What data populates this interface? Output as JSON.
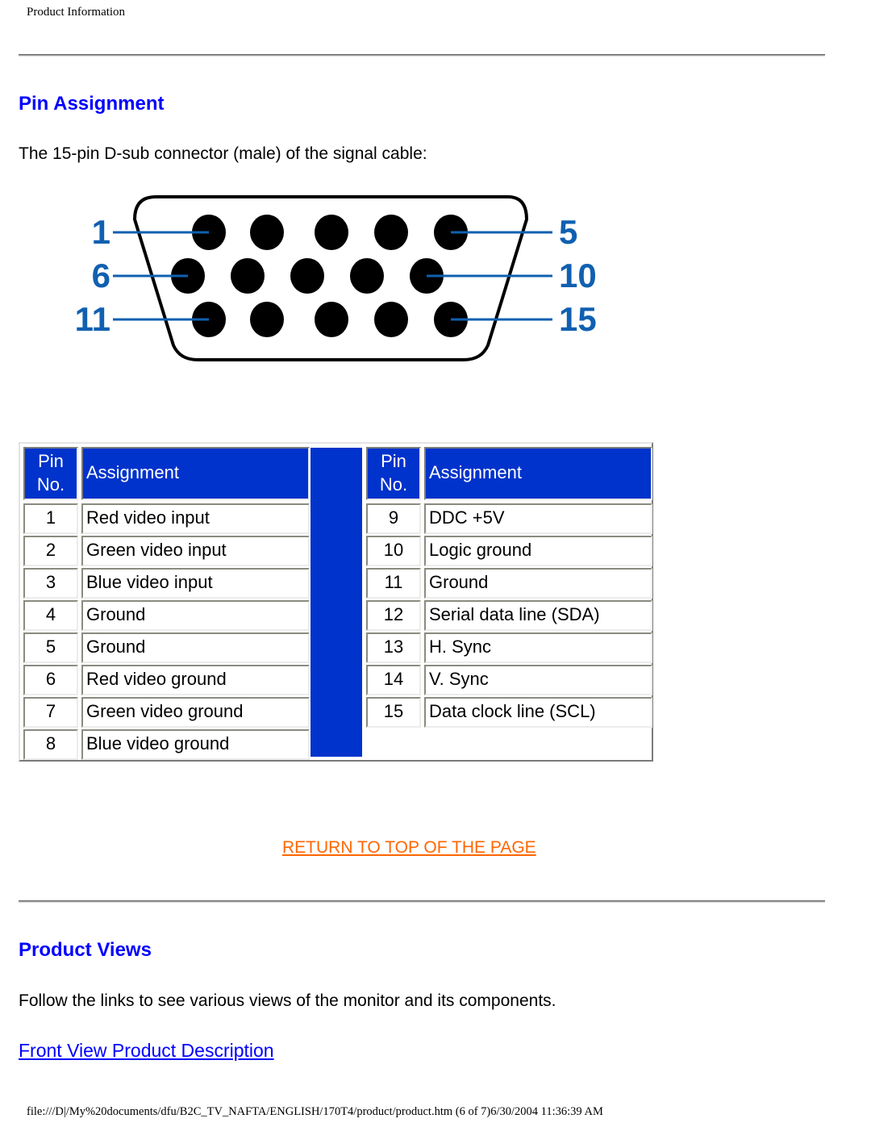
{
  "header": {
    "title": "Product Information"
  },
  "pin_assignment": {
    "heading": "Pin Assignment",
    "intro": "The 15-pin D-sub connector (male) of the signal cable:",
    "diagram": {
      "icon": "vga-connector-diagram",
      "row_labels": [
        {
          "left": "1",
          "right": "5"
        },
        {
          "left": "6",
          "right": "10"
        },
        {
          "left": "11",
          "right": "15"
        }
      ],
      "pin_color": "#000000",
      "label_color": "#1060b0"
    },
    "table": {
      "header_color": "#0033cc",
      "left": {
        "col_pin": "Pin No.",
        "col_pin_line1": "Pin",
        "col_pin_line2": "No.",
        "col_assign": "Assignment",
        "rows": [
          {
            "pin": "1",
            "assignment": "Red video input"
          },
          {
            "pin": "2",
            "assignment": "Green video input"
          },
          {
            "pin": "3",
            "assignment": "Blue video input"
          },
          {
            "pin": "4",
            "assignment": "Ground"
          },
          {
            "pin": "5",
            "assignment": "Ground"
          },
          {
            "pin": "6",
            "assignment": "Red video ground"
          },
          {
            "pin": "7",
            "assignment": "Green video ground"
          },
          {
            "pin": "8",
            "assignment": "Blue video ground"
          }
        ]
      },
      "right": {
        "col_pin": "Pin No.",
        "col_pin_line1": "Pin",
        "col_pin_line2": "No.",
        "col_assign": "Assignment",
        "rows": [
          {
            "pin": "9",
            "assignment": "DDC +5V"
          },
          {
            "pin": "10",
            "assignment": "Logic ground"
          },
          {
            "pin": "11",
            "assignment": "Ground"
          },
          {
            "pin": "12",
            "assignment": "Serial data line (SDA)"
          },
          {
            "pin": "13",
            "assignment": "H. Sync"
          },
          {
            "pin": "14",
            "assignment": "V. Sync"
          },
          {
            "pin": "15",
            "assignment": "Data clock line (SCL)"
          }
        ]
      }
    },
    "return_link": "RETURN TO TOP OF THE PAGE",
    "return_link_color": "#ff6600"
  },
  "product_views": {
    "heading": "Product Views",
    "text": "Follow the links to see various views of the monitor and its components.",
    "links": [
      {
        "label": "Front View Product Description"
      }
    ]
  },
  "footer": {
    "text": "file:///D|/My%20documents/dfu/B2C_TV_NAFTA/ENGLISH/170T4/product/product.htm (6 of 7)6/30/2004 11:36:39 AM"
  }
}
